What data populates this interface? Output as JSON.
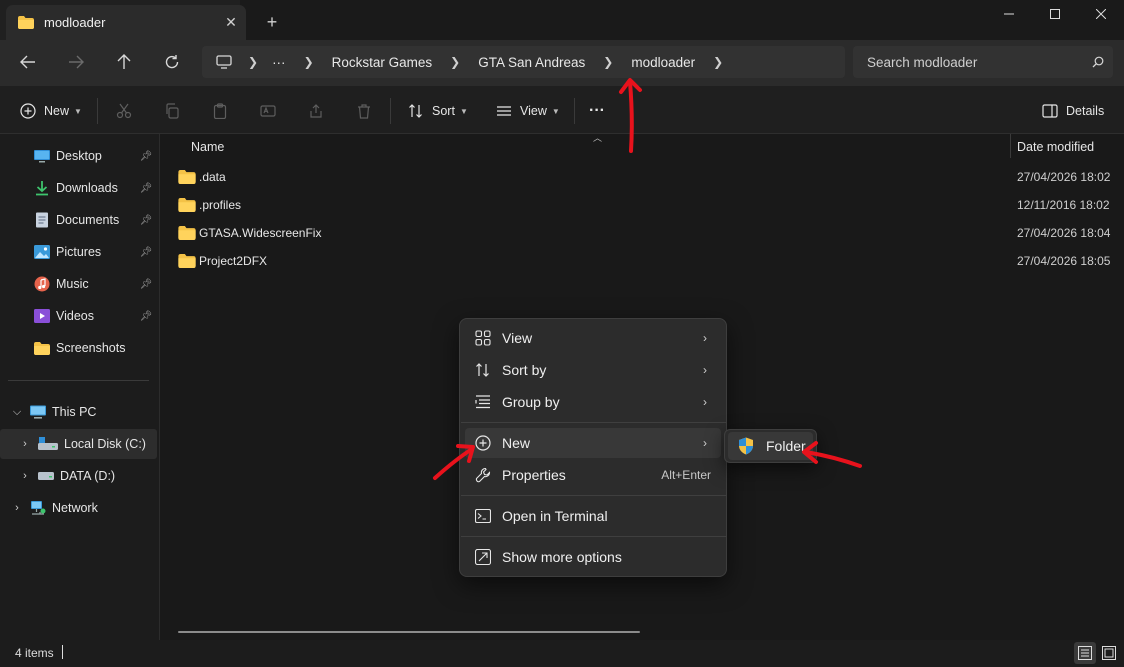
{
  "window": {
    "tab_title": "modloader",
    "new_tab": "+",
    "close_glyph": "✕"
  },
  "nav": {
    "breadcrumbs": [
      "Rockstar Games",
      "GTA San Andreas",
      "modloader"
    ],
    "ellipsis": "···",
    "search_placeholder": "Search modloader"
  },
  "toolbar": {
    "new_label": "New",
    "sort_label": "Sort",
    "view_label": "View",
    "more_label": "···",
    "details_label": "Details"
  },
  "sidebar": {
    "quick_access": [
      {
        "label": "Desktop",
        "icon": "desktop-icon"
      },
      {
        "label": "Downloads",
        "icon": "download-icon"
      },
      {
        "label": "Documents",
        "icon": "document-icon"
      },
      {
        "label": "Pictures",
        "icon": "picture-icon"
      },
      {
        "label": "Music",
        "icon": "music-icon"
      },
      {
        "label": "Videos",
        "icon": "video-icon"
      },
      {
        "label": "Screenshots",
        "icon": "folder-icon"
      }
    ],
    "this_pc": "This PC",
    "local_disk": "Local Disk (C:)",
    "data_drive": "DATA (D:)",
    "network": "Network"
  },
  "content": {
    "columns": {
      "name": "Name",
      "date": "Date modified"
    },
    "files": [
      {
        "name": ".data",
        "date": "27/04/2026 18:02"
      },
      {
        "name": ".profiles",
        "date": "12/11/2016 18:02"
      },
      {
        "name": "GTASA.WidescreenFix",
        "date": "27/04/2026 18:04"
      },
      {
        "name": "Project2DFX",
        "date": "27/04/2026 18:05"
      }
    ]
  },
  "status": {
    "items": "4 items"
  },
  "context_menu": {
    "view": "View",
    "sort_by": "Sort by",
    "group_by": "Group by",
    "new": "New",
    "properties": "Properties",
    "properties_shortcut": "Alt+Enter",
    "open_terminal": "Open in Terminal",
    "show_more": "Show more options",
    "submenu_folder": "Folder"
  },
  "colors": {
    "folder": "#f4c247",
    "accent": "#4cc2ff",
    "annotation": "#e8121c"
  }
}
